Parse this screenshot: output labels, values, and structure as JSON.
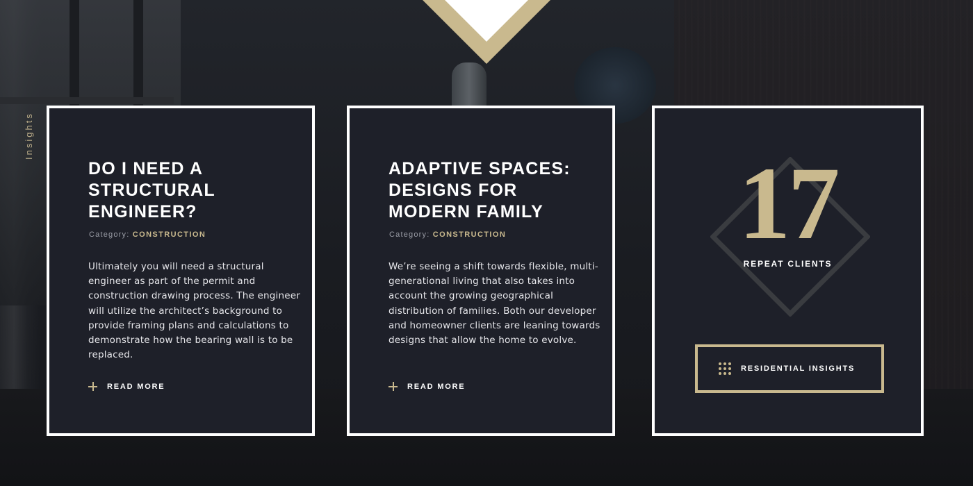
{
  "side_label": "Insights",
  "colors": {
    "accent_gold": "#c9b98e",
    "card_bg": "#1e2029",
    "card_border": "#ffffff"
  },
  "cards": [
    {
      "title": "DO I NEED A STRUCTURAL ENGINEER?",
      "category_label": "Category:",
      "category_value": "CONSTRUCTION",
      "body": "Ultimately you will need a structural engineer as part of the permit and construction drawing process. The engineer will utilize the architect’s background to provide framing plans and calculations to demonstrate how the bearing wall is to be replaced.",
      "read_more": "READ MORE",
      "read_more_icon": "plus-icon"
    },
    {
      "title": "ADAPTIVE SPACES: DESIGNS FOR MODERN FAMILY",
      "category_label": "Category:",
      "category_value": "CONSTRUCTION",
      "body": "We’re seeing a shift towards flexible, multi-generational living that also takes into account the growing geographical distribution of families. Both our developer and homeowner clients are leaning towards designs that allow the home to evolve.",
      "read_more": "READ MORE",
      "read_more_icon": "plus-icon"
    }
  ],
  "stat": {
    "number": "17",
    "label": "REPEAT CLIENTS"
  },
  "insights_button": {
    "label": "RESIDENTIAL INSIGHTS",
    "icon": "grid-dots-icon"
  }
}
